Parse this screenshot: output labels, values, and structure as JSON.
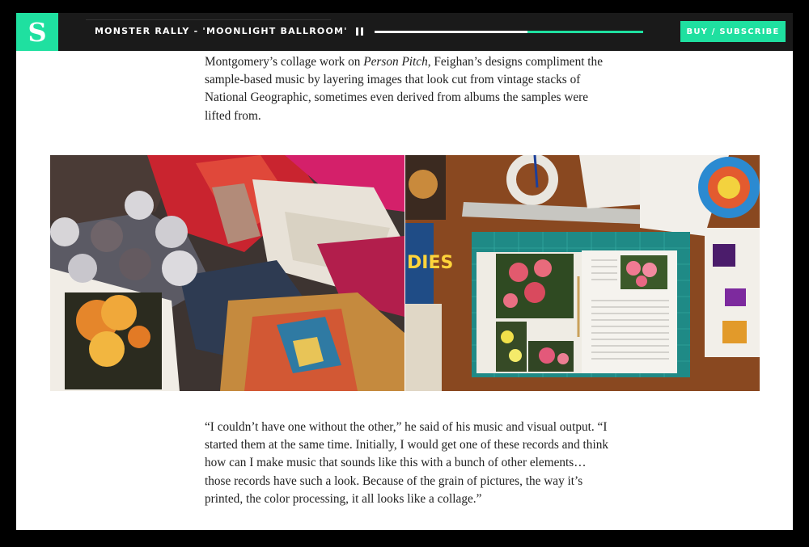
{
  "header": {
    "logo_letter": "S",
    "track_title": "MONSTER RALLY - 'MOONLIGHT BALLROOM'",
    "progress": 0.57,
    "buy_label": "BUY / SUBSCRIBE",
    "accent_color": "#1fe0a0"
  },
  "article": {
    "para1_before": "Montgomery’s collage work on ",
    "para1_italic": "Person Pitch",
    "para1_after": ", Feighan’s designs compliment the sample-based music by layering images that look cut from vintage stacks of National Geographic, sometimes even derived from albums the samples were lifted from.",
    "para2": "“I couldn’t have one without the other,” he said of his music and visual output. “I started them at the same time. Initially, I would get one of these records and think how can I make music that sounds like this with a bunch of other elements… those records have such a look. Because of the grain of pictures, the way it’s printed, the color processing, it all looks like a collage.”"
  },
  "photos": {
    "left_alt": "collage-cutouts-photo",
    "right_alt": "collage-workspace-photo",
    "right_magazine_text": "DIES"
  }
}
